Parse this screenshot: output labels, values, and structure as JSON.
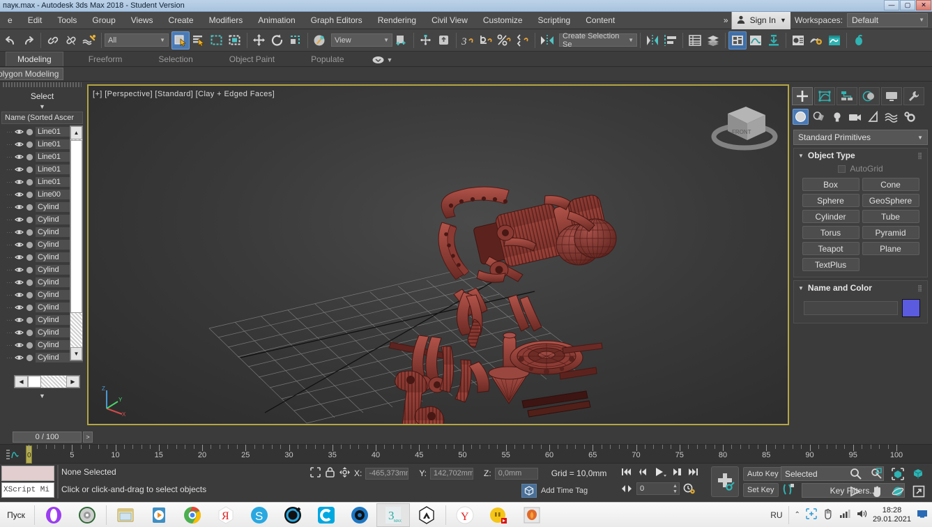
{
  "titlebar": {
    "title": "паук.max - Autodesk 3ds Max 2018 - Student Version",
    "minimize": "—",
    "maximize": "▢",
    "close": "✕"
  },
  "menubar": {
    "items": [
      "e",
      "Edit",
      "Tools",
      "Group",
      "Views",
      "Create",
      "Modifiers",
      "Animation",
      "Graph Editors",
      "Rendering",
      "Civil View",
      "Customize",
      "Scripting",
      "Content"
    ],
    "overflow": "»",
    "signin": "Sign In",
    "workspaces_label": "Workspaces:",
    "workspace_value": "Default"
  },
  "toolbar": {
    "selection_filter": "All",
    "reference_coord": "View",
    "named_selection": "Create Selection Se"
  },
  "ribbon": {
    "tabs": [
      "Modeling",
      "Freeform",
      "Selection",
      "Object Paint",
      "Populate"
    ],
    "active_tab": "Modeling",
    "subtab": "olygon Modeling"
  },
  "scene_explorer": {
    "title": "Select",
    "column_header": "Name (Sorted Ascer",
    "objects": [
      "Cylind",
      "Cylind",
      "Cylind",
      "Cylind",
      "Cylind",
      "Cylind",
      "Cylind",
      "Cylind",
      "Cylind",
      "Cylind",
      "Cylind",
      "Cylind",
      "Cylind",
      "Line00",
      "Line01",
      "Line01",
      "Line01",
      "Line01",
      "Line01"
    ]
  },
  "viewport": {
    "label": "[+] [Perspective] [Standard] [Clay + Edged Faces]",
    "viewcube_front": "FRONT",
    "axis_x": "X",
    "axis_y": "Y",
    "axis_z": "Z"
  },
  "command_panel": {
    "tabs": [
      "create-tab",
      "modify-tab",
      "hierarchy-tab",
      "motion-tab",
      "display-tab",
      "utilities-tab"
    ],
    "sub_icons": [
      "geometry-icon",
      "shapes-icon",
      "lights-icon",
      "cameras-icon",
      "helpers-icon",
      "space-warps-icon",
      "systems-icon"
    ],
    "category": "Standard Primitives",
    "object_type_title": "Object Type",
    "autogrid_label": "AutoGrid",
    "object_buttons": [
      "Box",
      "Cone",
      "Sphere",
      "GeoSphere",
      "Cylinder",
      "Tube",
      "Torus",
      "Pyramid",
      "Teapot",
      "Plane",
      "TextPlus"
    ],
    "name_and_color_title": "Name and Color",
    "name_value": "",
    "color_hex": "#5b5be0"
  },
  "time_slider": {
    "value": "0 / 100",
    "next_arrow": ">"
  },
  "ruler": {
    "labels": [
      "0",
      "5",
      "10",
      "15",
      "20",
      "25",
      "30",
      "35",
      "40",
      "45",
      "50",
      "55",
      "60",
      "65",
      "70",
      "75",
      "80",
      "85",
      "90",
      "95",
      "100"
    ],
    "min": 0,
    "max": 100
  },
  "statusbar": {
    "maxscript_mini": "XScript Mi",
    "selection_status": "None Selected",
    "prompt": "Click or click-and-drag to select objects",
    "x_label": "X:",
    "x_value": "-465,373mm",
    "y_label": "Y:",
    "y_value": "142,702mm",
    "z_label": "Z:",
    "z_value": "0,0mm",
    "grid": "Grid = 10,0mm",
    "add_time_tag": "Add Time Tag",
    "frame_value": "0",
    "auto_key": "Auto Key",
    "set_key": "Set Key",
    "key_mode": "Selected",
    "key_filters": "Key Filters..."
  },
  "taskbar": {
    "start": "Пуск",
    "apps": [
      "opera-icon",
      "disc-icon",
      "folder-icon",
      "media-player-icon",
      "chrome-icon",
      "yandex-icon",
      "skype-icon",
      "opera-gx-icon",
      "c-icon",
      "aperture-icon",
      "3dsmax-icon",
      "autodesk-icon",
      "yandex-browser-icon",
      "emoji-icon",
      "photo-icon"
    ],
    "language": "RU",
    "tray": [
      "chevron-up-icon",
      "snip-icon",
      "hand-icon",
      "network-icon",
      "volume-icon"
    ],
    "time": "18:28",
    "date": "29.01.2021"
  }
}
